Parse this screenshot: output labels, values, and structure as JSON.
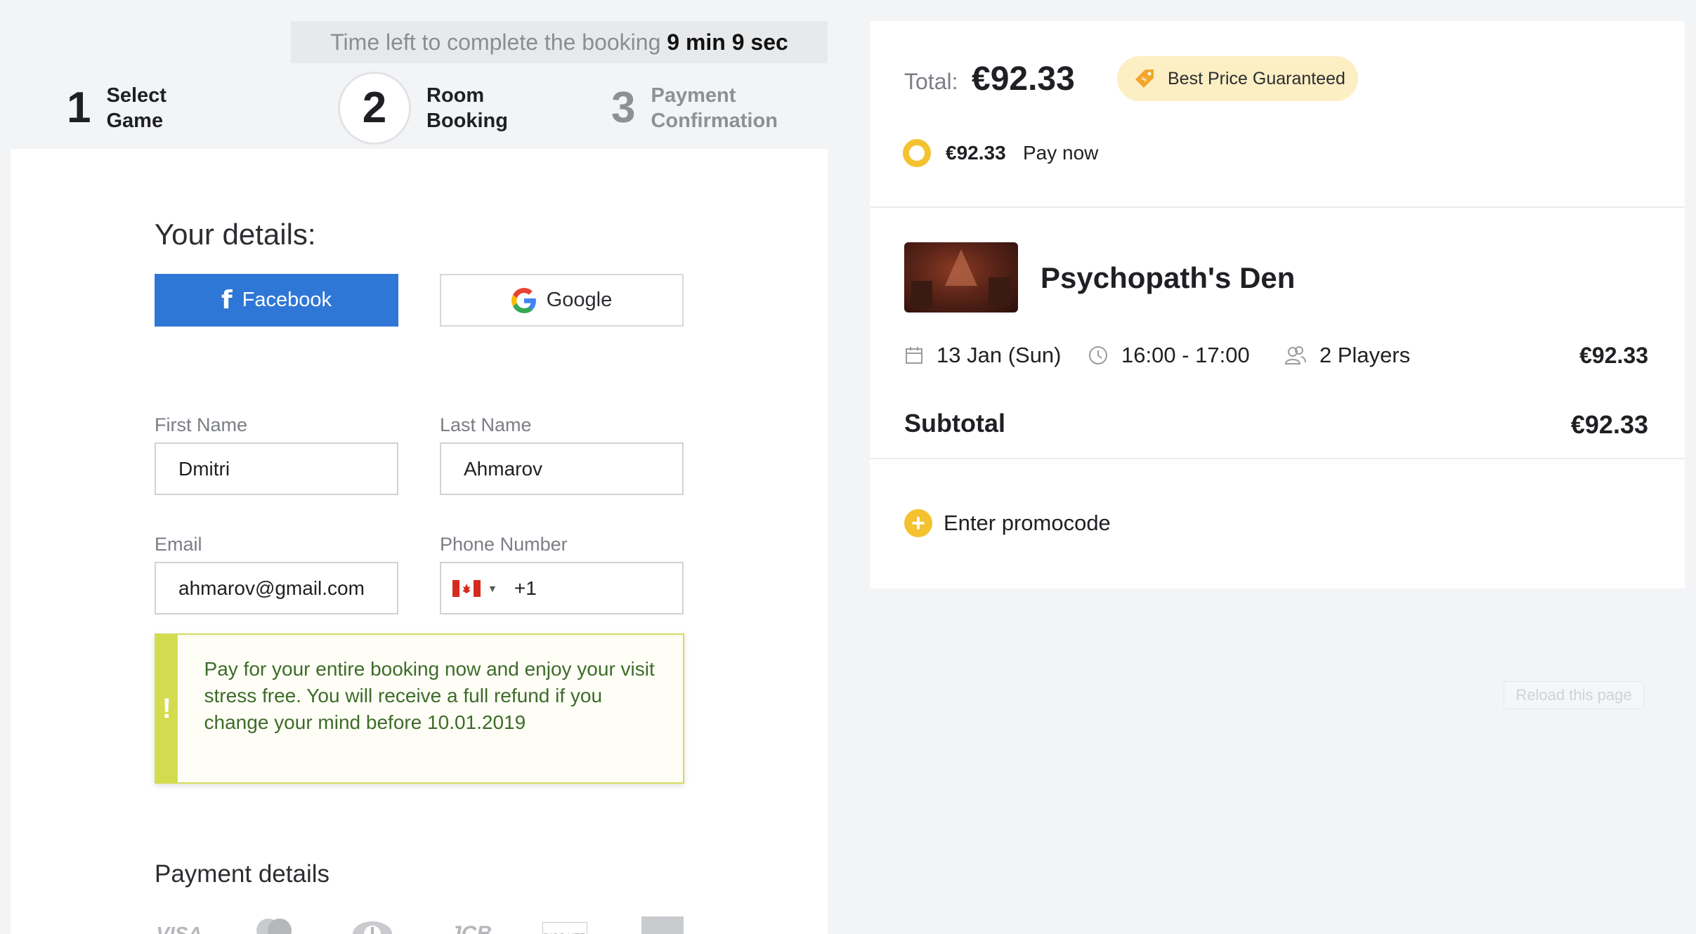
{
  "timer": {
    "prefix": "Time left to complete the booking",
    "value": "9 min 9 sec"
  },
  "steps": [
    {
      "num": "1",
      "line1": "Select",
      "line2": "Game"
    },
    {
      "num": "2",
      "line1": "Room",
      "line2": "Booking"
    },
    {
      "num": "3",
      "line1": "Payment",
      "line2": "Confirmation"
    }
  ],
  "details": {
    "title": "Your details:",
    "facebook_label": "Facebook",
    "google_label": "Google"
  },
  "form": {
    "first_name_label": "First Name",
    "first_name_value": "Dmitri",
    "last_name_label": "Last Name",
    "last_name_value": "Ahmarov",
    "email_label": "Email",
    "email_value": "ahmarov@gmail.com",
    "phone_label": "Phone Number",
    "phone_code": "+1"
  },
  "notice": {
    "icon": "!",
    "text": "Pay for your entire booking now and enjoy your visit stress free. You will receive a full refund if you change your mind before 10.01.2019"
  },
  "payment": {
    "title": "Payment details",
    "cards": [
      "VISA",
      "mastercard",
      "",
      "JCB",
      "DISC VER",
      ""
    ]
  },
  "summary": {
    "total_label": "Total:",
    "total_value": "€92.33",
    "badge": "Best Price Guaranteed",
    "pay_amount": "€92.33",
    "pay_now": "Pay now",
    "room_title": "Psychopath's Den",
    "date": "13 Jan (Sun)",
    "time": "16:00 - 17:00",
    "players": "2 Players",
    "line_price": "€92.33",
    "subtotal_label": "Subtotal",
    "subtotal_value": "€92.33",
    "promo": "Enter promocode"
  },
  "reload": "Reload this page",
  "colors": {
    "accent": "#f4c230",
    "facebook": "#2f77d6",
    "notice": "#d3dc4e"
  }
}
